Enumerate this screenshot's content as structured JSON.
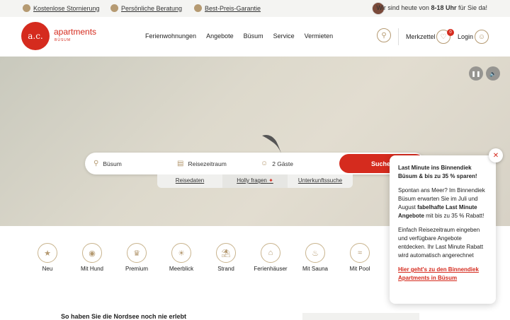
{
  "topbar": {
    "usps": [
      "Kostenlose Stornierung",
      "Persönliche Beratung",
      "Best-Preis-Garantie"
    ],
    "hotline_pre": "Wir sind heute von ",
    "hotline_hours": "8-18 Uhr",
    "hotline_post": " für Sie da!"
  },
  "header": {
    "logo_mark": "a.c.",
    "logo_text": "apartments",
    "logo_sub": "BÜSUM",
    "nav": [
      "Ferienwohnungen",
      "Angebote",
      "Büsum",
      "Service",
      "Vermieten"
    ],
    "merkzettel": "Merkzettel",
    "merkzettel_count": "0",
    "login": "Login"
  },
  "search": {
    "location": "Büsum",
    "dates": "Reisezeitraum",
    "guests": "2 Gäste",
    "button": "Suchen",
    "tabs": [
      "Reisedaten",
      "Holly fragen",
      "Unterkunftssuche"
    ]
  },
  "categories": [
    "Neu",
    "Mit Hund",
    "Premium",
    "Meerblick",
    "Strand",
    "Ferienhäuser",
    "Mit Sauna",
    "Mit Pool"
  ],
  "intro": "So haben Sie die Nordsee noch nie erlebt",
  "popup": {
    "title": "Last Minute ins Binnendiek Büsum & bis zu 35 % sparen!",
    "p1_a": "Spontan ans Meer? Im Binnendiek Büsum erwarten Sie im Juli und August ",
    "p1_b": "fabelhafte Last Minute Angebote",
    "p1_c": " mit bis zu 35 % Rabatt!",
    "p2": "Einfach Reisezeitraum eingeben und verfügbare Angebote entdecken. Ihr Last Minute Rabatt wird automatisch angerechnet",
    "link": "Hier geht's zu den Binnendiek Apartments in Büsum"
  },
  "colors": {
    "accent": "#d52b1e",
    "gold": "#b59a72"
  }
}
